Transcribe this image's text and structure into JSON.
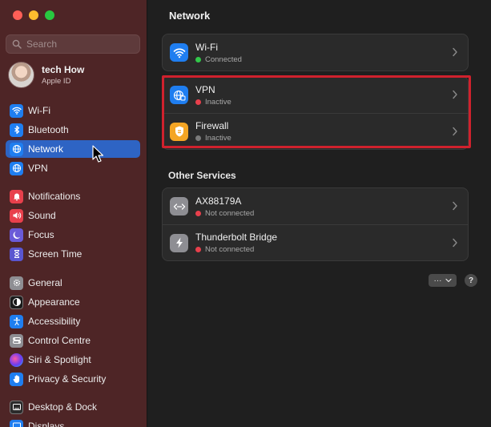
{
  "sidebar": {
    "search_placeholder": "Search",
    "account": {
      "name": "tech How",
      "subtitle": "Apple ID"
    },
    "items": [
      {
        "label": "Wi-Fi",
        "icon": "wifi-icon",
        "color": "#1f7ef0"
      },
      {
        "label": "Bluetooth",
        "icon": "bluetooth-icon",
        "color": "#1f7ef0"
      },
      {
        "label": "Network",
        "icon": "globe-icon",
        "color": "#1f7ef0",
        "selected": true
      },
      {
        "label": "VPN",
        "icon": "globe-icon",
        "color": "#1f7ef0"
      },
      {
        "label": "Notifications",
        "icon": "bell-icon",
        "color": "#e8404c"
      },
      {
        "label": "Sound",
        "icon": "speaker-icon",
        "color": "#e8404c"
      },
      {
        "label": "Focus",
        "icon": "moon-icon",
        "color": "#6a5bd8"
      },
      {
        "label": "Screen Time",
        "icon": "hourglass-icon",
        "color": "#5a56d0"
      },
      {
        "label": "General",
        "icon": "gear-icon",
        "color": "#8e8e93"
      },
      {
        "label": "Appearance",
        "icon": "appearance-icon",
        "color": "#1a1a1a"
      },
      {
        "label": "Accessibility",
        "icon": "accessibility-icon",
        "color": "#1f7ef0"
      },
      {
        "label": "Control Centre",
        "icon": "control-centre-icon",
        "color": "#8e8e93"
      },
      {
        "label": "Siri & Spotlight",
        "icon": "siri-icon",
        "color": "#6a3cf0"
      },
      {
        "label": "Privacy & Security",
        "icon": "hand-icon",
        "color": "#1f7ef0"
      },
      {
        "label": "Desktop & Dock",
        "icon": "desktop-icon",
        "color": "#2a2a2a"
      },
      {
        "label": "Displays",
        "icon": "display-icon",
        "color": "#1f7ef0"
      }
    ]
  },
  "main": {
    "title": "Network",
    "services": [
      {
        "name": "Wi-Fi",
        "status": "Connected",
        "status_color": "#32c84a",
        "icon": "wifi-icon"
      },
      {
        "name": "VPN",
        "status": "Inactive",
        "status_color": "#e8404c",
        "icon": "vpn-globe-icon"
      },
      {
        "name": "Firewall",
        "status": "Inactive",
        "status_color": "#7a7a7a",
        "icon": "firewall-icon"
      }
    ],
    "other_services_title": "Other Services",
    "other_services": [
      {
        "name": "AX88179A",
        "status": "Not connected",
        "status_color": "#e8404c",
        "icon": "ethernet-icon"
      },
      {
        "name": "Thunderbolt Bridge",
        "status": "Not connected",
        "status_color": "#e8404c",
        "icon": "thunderbolt-icon"
      }
    ],
    "more_button_label": "···",
    "help_button_label": "?"
  },
  "annotation": {
    "highlight_color": "#d0212d"
  }
}
